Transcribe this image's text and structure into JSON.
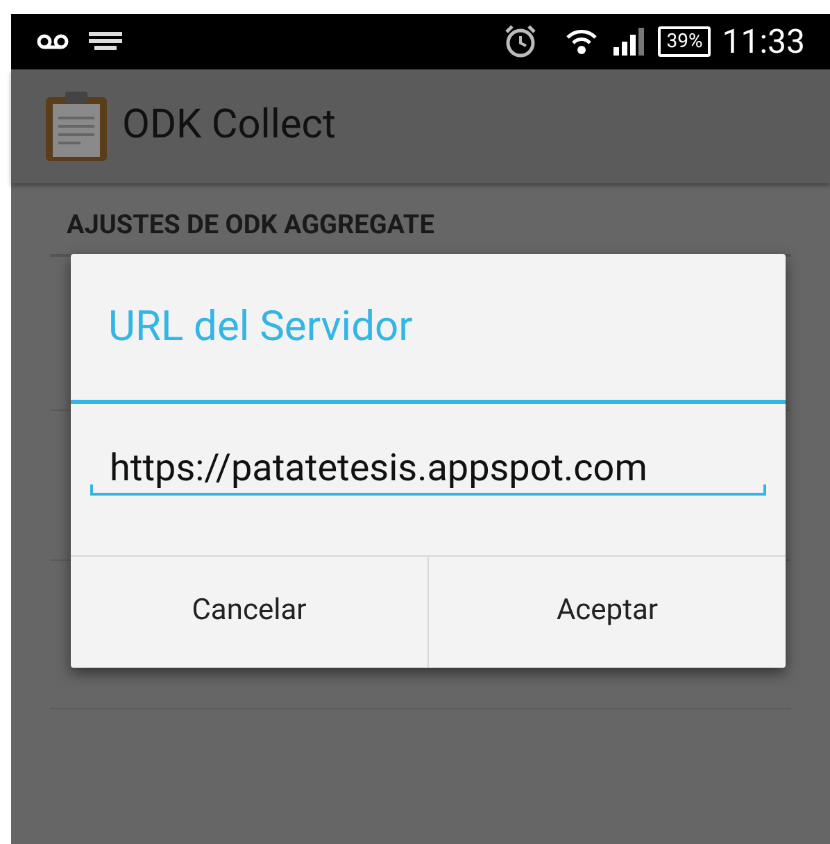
{
  "status_bar": {
    "battery": "39%",
    "time": "11:33"
  },
  "action_bar": {
    "title": "ODK Collect"
  },
  "settings": {
    "section_header": "AJUSTES DE ODK AGGREGATE"
  },
  "dialog": {
    "title": "URL del Servidor",
    "input_value": "https://patatetesis.appspot.com",
    "buttons": [
      "Cancelar",
      "Aceptar"
    ]
  }
}
